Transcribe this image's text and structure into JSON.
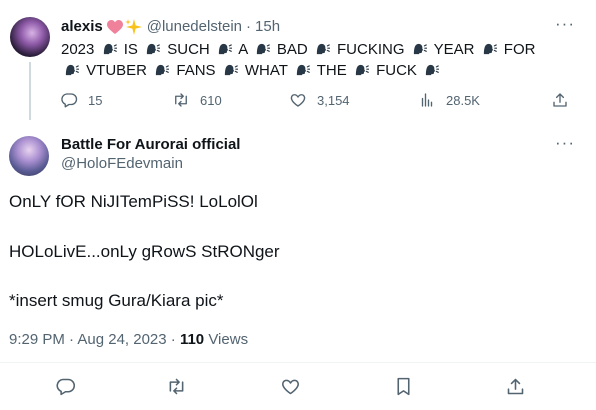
{
  "tweet1": {
    "display_name": "alexis",
    "name_emojis": "❤️✨",
    "handle": "@lunedelstein",
    "separator": "·",
    "time": "15h",
    "body_words": [
      "2023",
      "IS",
      "SUCH",
      "A",
      "BAD",
      "FUCKING",
      "YEAR",
      "FOR",
      "VTUBER",
      "FANS",
      "WHAT",
      "THE",
      "FUCK"
    ],
    "speaking_emoji": "speaking-head-icon",
    "stats": {
      "replies": "15",
      "retweets": "610",
      "likes": "3,154",
      "views": "28.5K"
    }
  },
  "tweet2": {
    "display_name": "Battle For Aurorai official",
    "handle": "@HoloFEdevmain",
    "lines": [
      "OnLY fOR NiJITemPiSS! LoLolOl",
      "HOLoLivE...onLy gRowS StRONger",
      "*insert smug Gura/Kiara pic*"
    ],
    "timestamp": "9:29 PM · Aug 24, 2023 ·",
    "views_count": "110",
    "views_label": "Views"
  },
  "colors": {
    "text": "#0f1419",
    "muted": "#536471",
    "divider": "#eff3f4",
    "thread": "#cfd9de",
    "heart": "#f0819b",
    "sparkle": "#f7c21b"
  }
}
